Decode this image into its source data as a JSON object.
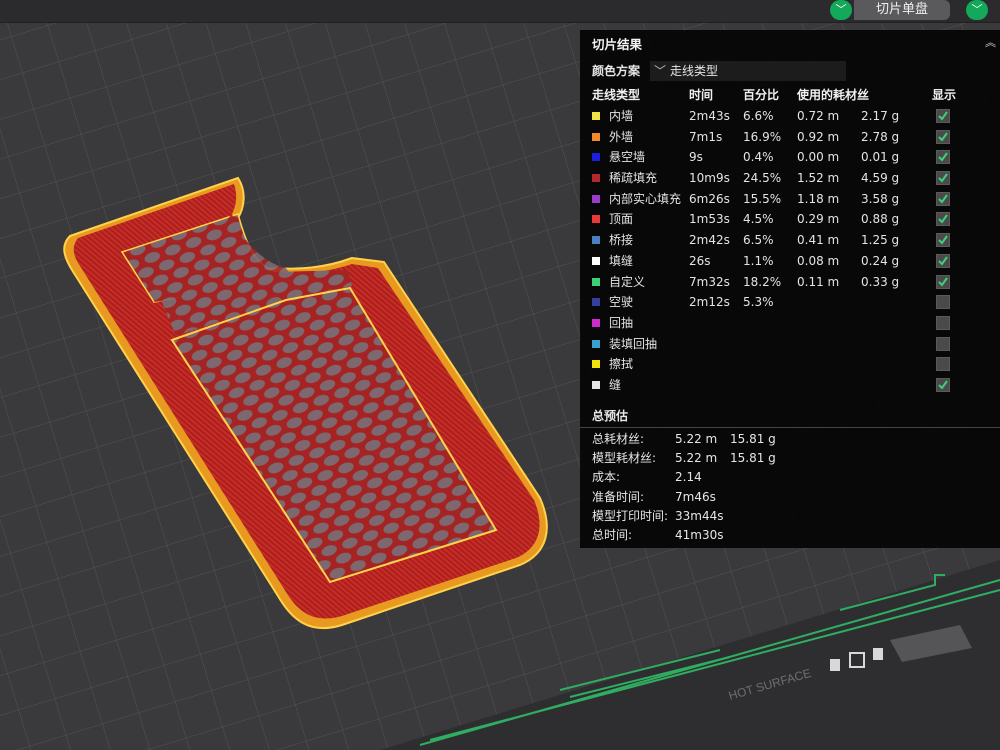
{
  "header": {
    "slice_button_label": "切片单盘"
  },
  "panel": {
    "title": "切片结果",
    "color_scheme_label": "颜色方案",
    "color_scheme_value": "走线类型",
    "columns": [
      "走线类型",
      "时间",
      "百分比",
      "使用的耗材丝",
      "显示"
    ],
    "rows": [
      {
        "name": "内墙",
        "color": "#f2e04a",
        "time": "2m43s",
        "percent": "6.6%",
        "len": "0.72 m",
        "weight": "2.17 g",
        "shown": true
      },
      {
        "name": "外墙",
        "color": "#f08a2a",
        "time": "7m1s",
        "percent": "16.9%",
        "len": "0.92 m",
        "weight": "2.78 g",
        "shown": true
      },
      {
        "name": "悬空墙",
        "color": "#1e1ee0",
        "time": "9s",
        "percent": "0.4%",
        "len": "0.00 m",
        "weight": "0.01 g",
        "shown": true
      },
      {
        "name": "稀疏填充",
        "color": "#b3282c",
        "time": "10m9s",
        "percent": "24.5%",
        "len": "1.52 m",
        "weight": "4.59 g",
        "shown": true
      },
      {
        "name": "内部实心填充",
        "color": "#9a3cc8",
        "time": "6m26s",
        "percent": "15.5%",
        "len": "1.18 m",
        "weight": "3.58 g",
        "shown": true
      },
      {
        "name": "顶面",
        "color": "#e83a3a",
        "time": "1m53s",
        "percent": "4.5%",
        "len": "0.29 m",
        "weight": "0.88 g",
        "shown": true
      },
      {
        "name": "桥接",
        "color": "#4a80c0",
        "time": "2m42s",
        "percent": "6.5%",
        "len": "0.41 m",
        "weight": "1.25 g",
        "shown": true
      },
      {
        "name": "填缝",
        "color": "#ffffff",
        "time": "26s",
        "percent": "1.1%",
        "len": "0.08 m",
        "weight": "0.24 g",
        "shown": true
      },
      {
        "name": "自定义",
        "color": "#3ecf7a",
        "time": "7m32s",
        "percent": "18.2%",
        "len": "0.11 m",
        "weight": "0.33 g",
        "shown": true
      },
      {
        "name": "空驶",
        "color": "#36409a",
        "time": "2m12s",
        "percent": "5.3%",
        "len": "",
        "weight": "",
        "shown": false
      },
      {
        "name": "回抽",
        "color": "#cc2ccc",
        "time": "",
        "percent": "",
        "len": "",
        "weight": "",
        "shown": false
      },
      {
        "name": "装填回抽",
        "color": "#3aa0d0",
        "time": "",
        "percent": "",
        "len": "",
        "weight": "",
        "shown": false
      },
      {
        "name": "擦拭",
        "color": "#f2e010",
        "time": "",
        "percent": "",
        "len": "",
        "weight": "",
        "shown": false
      },
      {
        "name": "缝",
        "color": "#e6e6e6",
        "time": "",
        "percent": "",
        "len": "",
        "weight": "",
        "shown": true
      }
    ],
    "summary_title": "总预估",
    "summary": [
      {
        "label": "总耗材丝:",
        "v1": "5.22 m",
        "v2": "15.81 g"
      },
      {
        "label": "模型耗材丝:",
        "v1": "5.22 m",
        "v2": "15.81 g"
      },
      {
        "label": "成本:",
        "v1": "2.14",
        "v2": ""
      },
      {
        "label": "准备时间:",
        "v1": "7m46s",
        "v2": ""
      },
      {
        "label": "模型打印时间:",
        "v1": "33m44s",
        "v2": ""
      },
      {
        "label": "总时间:",
        "v1": "41m30s",
        "v2": ""
      }
    ]
  },
  "bed": {
    "label": "HOT SURFACE",
    "plate_line_color": "#2fae62"
  }
}
